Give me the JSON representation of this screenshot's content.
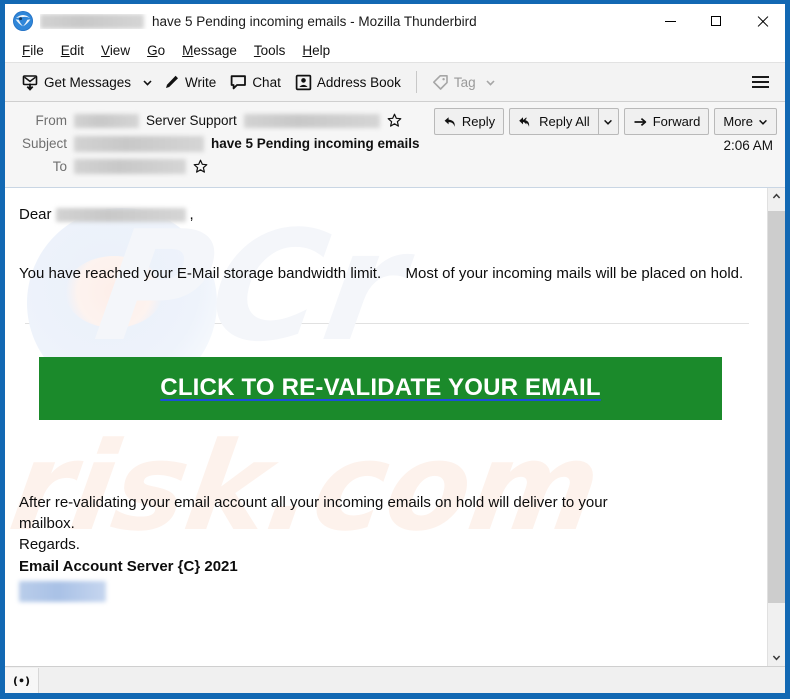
{
  "window": {
    "title_suffix": "have 5 Pending incoming emails - Mozilla Thunderbird",
    "app_icon": "thunderbird-icon",
    "minimize_label": "Minimize",
    "maximize_label": "Maximize",
    "close_label": "Close"
  },
  "menubar": {
    "items": [
      {
        "label": "File",
        "accesskey": "F"
      },
      {
        "label": "Edit",
        "accesskey": "E"
      },
      {
        "label": "View",
        "accesskey": "V"
      },
      {
        "label": "Go",
        "accesskey": "G"
      },
      {
        "label": "Message",
        "accesskey": "M"
      },
      {
        "label": "Tools",
        "accesskey": "T"
      },
      {
        "label": "Help",
        "accesskey": "H"
      }
    ]
  },
  "toolbar": {
    "get_messages_label": "Get Messages",
    "get_messages_icon": "download-mail-icon",
    "write_label": "Write",
    "write_icon": "pencil-icon",
    "chat_label": "Chat",
    "chat_icon": "speech-bubble-icon",
    "address_book_label": "Address Book",
    "address_book_icon": "contact-card-icon",
    "tag_label": "Tag",
    "tag_icon": "tag-icon",
    "menu_icon": "hamburger-icon"
  },
  "message_header": {
    "from_label": "From",
    "from_sender": "Server Support",
    "subject_label": "Subject",
    "subject_text": "have 5 Pending incoming emails",
    "to_label": "To",
    "time": "2:06 AM",
    "star_icon": "star-icon",
    "actions": {
      "reply_label": "Reply",
      "reply_icon": "reply-arrow-icon",
      "reply_all_label": "Reply All",
      "reply_all_icon": "reply-all-arrow-icon",
      "reply_all_dropdown_icon": "chevron-down-icon",
      "forward_label": "Forward",
      "forward_icon": "forward-arrow-icon",
      "more_label": "More",
      "more_dropdown_icon": "chevron-down-icon"
    }
  },
  "mail_body": {
    "greeting_prefix": "Dear",
    "greeting_suffix": ",",
    "paragraph_1a": "You have reached your E-Mail storage bandwidth limit.",
    "paragraph_1b": "Most of your incoming mails will be placed on hold.",
    "cta_label": "CLICK TO RE-VALIDATE YOUR EMAIL",
    "closing_line_1": "After re-validating your email account all your incoming emails on hold will deliver to your mailbox.",
    "closing_line_2": "Regards.",
    "signature": "Email Account Server {C} 2021",
    "watermark_1": "PCrisk",
    "watermark_2": "risk.com"
  },
  "scrollbar": {
    "up_icon": "chevron-up-icon",
    "down_icon": "chevron-down-icon"
  },
  "statusbar": {
    "connection_icon": "broadcast-signal-icon"
  },
  "colors": {
    "window_border": "#1268b3",
    "cta_green": "#1b8a2b",
    "cta_underline_blue": "#1b4fd8",
    "toolbar_bg": "#f3f3f3",
    "header_bg": "#f6f6f6"
  }
}
